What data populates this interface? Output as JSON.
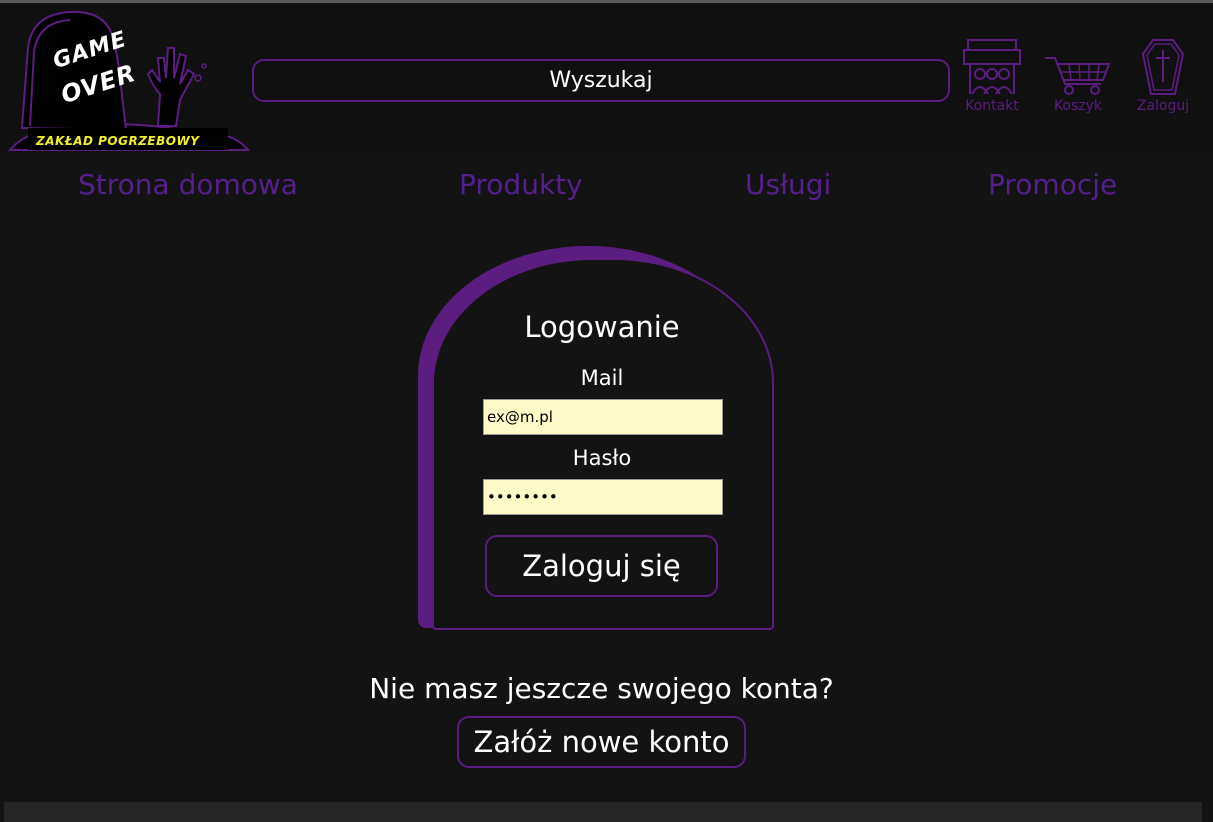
{
  "logo": {
    "line1": "GAME",
    "line2": "OVER",
    "subtitle": "ZAKŁAD POGRZEBOWY"
  },
  "search": {
    "placeholder": "Wyszukaj"
  },
  "top_icons": [
    {
      "label": "Kontakt",
      "icon": "contact-icon"
    },
    {
      "label": "Koszyk",
      "icon": "cart-icon"
    },
    {
      "label": "Zaloguj",
      "icon": "coffin-icon"
    }
  ],
  "nav": {
    "home": "Strona domowa",
    "products": "Produkty",
    "services": "Usługi",
    "promotions": "Promocje"
  },
  "login": {
    "title": "Logowanie",
    "mail_label": "Mail",
    "mail_value": "ex@m.pl",
    "password_label": "Hasło",
    "password_value": "••••••••",
    "submit": "Zaloguj się"
  },
  "register": {
    "prompt": "Nie masz jeszcze swojego konta?",
    "button": "Załóż nowe konto"
  },
  "colors": {
    "accent": "#5b1d80",
    "background": "#131313",
    "input_bg": "#fffac8",
    "logo_yellow": "#f4ef2a"
  }
}
